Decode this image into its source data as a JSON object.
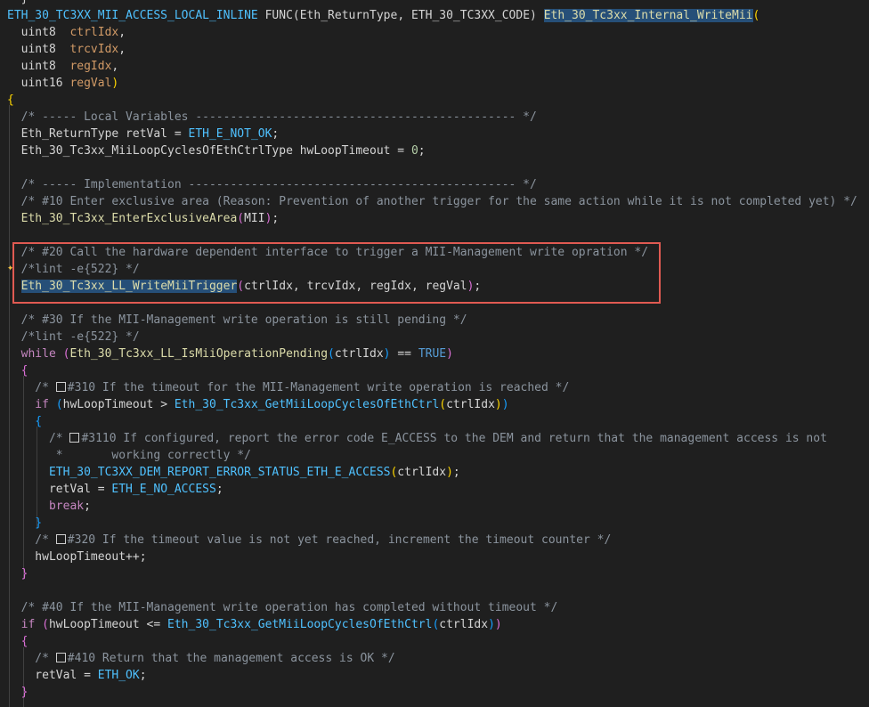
{
  "editor": {
    "lines": [
      {
        "t": "}",
        "indent": 1
      },
      {
        "segments": [
          {
            "cls": "macro",
            "text": "ETH_30_TC3XX_MII_ACCESS_LOCAL_INLINE"
          },
          {
            "cls": "punc",
            "text": " FUNC("
          },
          {
            "cls": "typ",
            "text": "Eth_ReturnType"
          },
          {
            "cls": "punc",
            "text": ", "
          },
          {
            "cls": "typ",
            "text": "ETH_30_TC3XX_CODE"
          },
          {
            "cls": "punc",
            "text": ") "
          },
          {
            "cls": "fn sel",
            "text": "Eth_30_Tc3xx_Internal_WriteMii"
          },
          {
            "cls": "brace1",
            "text": "("
          }
        ]
      },
      {
        "segments": [
          {
            "cls": "typ",
            "text": "  uint8  "
          },
          {
            "cls": "param",
            "text": "ctrlIdx"
          },
          {
            "cls": "punc",
            "text": ","
          }
        ]
      },
      {
        "segments": [
          {
            "cls": "typ",
            "text": "  uint8  "
          },
          {
            "cls": "param",
            "text": "trcvIdx"
          },
          {
            "cls": "punc",
            "text": ","
          }
        ]
      },
      {
        "segments": [
          {
            "cls": "typ",
            "text": "  uint8  "
          },
          {
            "cls": "param",
            "text": "regIdx"
          },
          {
            "cls": "punc",
            "text": ","
          }
        ]
      },
      {
        "segments": [
          {
            "cls": "typ",
            "text": "  uint16 "
          },
          {
            "cls": "param",
            "text": "regVal"
          },
          {
            "cls": "brace1",
            "text": ")"
          }
        ]
      },
      {
        "segments": [
          {
            "cls": "brace1",
            "text": "{"
          }
        ]
      },
      {
        "segments": [
          {
            "cls": "com",
            "text": "  /* ----- Local Variables ---------------------------------------------- */"
          }
        ]
      },
      {
        "segments": [
          {
            "cls": "typ",
            "text": "  Eth_ReturnType retVal = "
          },
          {
            "cls": "macro",
            "text": "ETH_E_NOT_OK"
          },
          {
            "cls": "punc",
            "text": ";"
          }
        ]
      },
      {
        "segments": [
          {
            "cls": "typ",
            "text": "  Eth_30_Tc3xx_MiiLoopCyclesOfEthCtrlType hwLoopTimeout = "
          },
          {
            "cls": "num",
            "text": "0"
          },
          {
            "cls": "punc",
            "text": ";"
          }
        ]
      },
      {
        "segments": [
          {
            "cls": "punc",
            "text": ""
          }
        ]
      },
      {
        "segments": [
          {
            "cls": "com",
            "text": "  /* ----- Implementation ----------------------------------------------- */"
          }
        ]
      },
      {
        "segments": [
          {
            "cls": "com",
            "text": "  /* #10 Enter exclusive area (Reason: Prevention of another trigger for the same action while it is not completed yet) */"
          }
        ]
      },
      {
        "segments": [
          {
            "cls": "fn macro",
            "text": "  Eth_30_Tc3xx_EnterExclusiveArea"
          },
          {
            "cls": "brace2",
            "text": "("
          },
          {
            "cls": "typ",
            "text": "MII"
          },
          {
            "cls": "brace2",
            "text": ")"
          },
          {
            "cls": "punc",
            "text": ";"
          }
        ]
      },
      {
        "segments": [
          {
            "cls": "punc",
            "text": ""
          }
        ]
      },
      {
        "segments": [
          {
            "cls": "com",
            "text": "  /* #20 Call the hardware dependent interface to trigger a MII-Management write opration */"
          }
        ]
      },
      {
        "segments": [
          {
            "cls": "com",
            "text": "  /*lint -e{522} */"
          }
        ]
      },
      {
        "segments": [
          {
            "cls": "punc",
            "text": "  "
          },
          {
            "cls": "fn sel",
            "text": "Eth_30_Tc3xx_LL_WriteMiiTrigger"
          },
          {
            "cls": "brace2",
            "text": "("
          },
          {
            "cls": "var",
            "text": "ctrlIdx, trcvIdx, regIdx, regVal"
          },
          {
            "cls": "brace2",
            "text": ")"
          },
          {
            "cls": "punc",
            "text": ";"
          }
        ]
      },
      {
        "segments": [
          {
            "cls": "punc",
            "text": ""
          }
        ]
      },
      {
        "segments": [
          {
            "cls": "com",
            "text": "  /* #30 If the MII-Management write operation is still pending */"
          }
        ]
      },
      {
        "segments": [
          {
            "cls": "com",
            "text": "  /*lint -e{522} */"
          }
        ]
      },
      {
        "segments": [
          {
            "cls": "ctrl",
            "text": "  while "
          },
          {
            "cls": "brace2",
            "text": "("
          },
          {
            "cls": "fn",
            "text": "Eth_30_Tc3xx_LL_IsMiiOperationPending"
          },
          {
            "cls": "brace3",
            "text": "("
          },
          {
            "cls": "var",
            "text": "ctrlIdx"
          },
          {
            "cls": "brace3",
            "text": ")"
          },
          {
            "cls": "punc",
            "text": " == "
          },
          {
            "cls": "kw",
            "text": "TRUE"
          },
          {
            "cls": "brace2",
            "text": ")"
          }
        ]
      },
      {
        "segments": [
          {
            "cls": "brace2",
            "text": "  {"
          }
        ]
      },
      {
        "segments": [
          {
            "cls": "com",
            "text": "    /* "
          },
          {
            "cls": "box",
            "text": ""
          },
          {
            "cls": "com",
            "text": "#310 If the timeout for the MII-Management write operation is reached */"
          }
        ]
      },
      {
        "segments": [
          {
            "cls": "ctrl",
            "text": "    if "
          },
          {
            "cls": "brace3",
            "text": "("
          },
          {
            "cls": "var",
            "text": "hwLoopTimeout > "
          },
          {
            "cls": "macro",
            "text": "Eth_30_Tc3xx_GetMiiLoopCyclesOfEthCtrl"
          },
          {
            "cls": "brace1",
            "text": "("
          },
          {
            "cls": "var",
            "text": "ctrlIdx"
          },
          {
            "cls": "brace1",
            "text": ")"
          },
          {
            "cls": "brace3",
            "text": ")"
          }
        ]
      },
      {
        "segments": [
          {
            "cls": "brace3",
            "text": "    {"
          }
        ]
      },
      {
        "segments": [
          {
            "cls": "com",
            "text": "      /* "
          },
          {
            "cls": "box",
            "text": ""
          },
          {
            "cls": "com",
            "text": "#3110 If configured, report the error code E_ACCESS to the DEM and return that the management access is not"
          }
        ]
      },
      {
        "segments": [
          {
            "cls": "com",
            "text": "       *       working correctly */"
          }
        ]
      },
      {
        "segments": [
          {
            "cls": "macro",
            "text": "      ETH_30_TC3XX_DEM_REPORT_ERROR_STATUS_ETH_E_ACCESS"
          },
          {
            "cls": "brace1",
            "text": "("
          },
          {
            "cls": "var",
            "text": "ctrlIdx"
          },
          {
            "cls": "brace1",
            "text": ")"
          },
          {
            "cls": "punc",
            "text": ";"
          }
        ]
      },
      {
        "segments": [
          {
            "cls": "var",
            "text": "      retVal = "
          },
          {
            "cls": "macro",
            "text": "ETH_E_NO_ACCESS"
          },
          {
            "cls": "punc",
            "text": ";"
          }
        ]
      },
      {
        "segments": [
          {
            "cls": "ctrl",
            "text": "      break"
          },
          {
            "cls": "punc",
            "text": ";"
          }
        ]
      },
      {
        "segments": [
          {
            "cls": "brace3",
            "text": "    }"
          }
        ]
      },
      {
        "segments": [
          {
            "cls": "com",
            "text": "    /* "
          },
          {
            "cls": "box",
            "text": ""
          },
          {
            "cls": "com",
            "text": "#320 If the timeout value is not yet reached, increment the timeout counter */"
          }
        ]
      },
      {
        "segments": [
          {
            "cls": "var",
            "text": "    hwLoopTimeout++;"
          }
        ]
      },
      {
        "segments": [
          {
            "cls": "brace2",
            "text": "  }"
          }
        ]
      },
      {
        "segments": [
          {
            "cls": "punc",
            "text": ""
          }
        ]
      },
      {
        "segments": [
          {
            "cls": "com",
            "text": "  /* #40 If the MII-Management write operation has completed without timeout */"
          }
        ]
      },
      {
        "segments": [
          {
            "cls": "ctrl",
            "text": "  if "
          },
          {
            "cls": "brace2",
            "text": "("
          },
          {
            "cls": "var",
            "text": "hwLoopTimeout <= "
          },
          {
            "cls": "macro",
            "text": "Eth_30_Tc3xx_GetMiiLoopCyclesOfEthCtrl"
          },
          {
            "cls": "brace3",
            "text": "("
          },
          {
            "cls": "var",
            "text": "ctrlIdx"
          },
          {
            "cls": "brace3",
            "text": ")"
          },
          {
            "cls": "brace2",
            "text": ")"
          }
        ]
      },
      {
        "segments": [
          {
            "cls": "brace2",
            "text": "  {"
          }
        ]
      },
      {
        "segments": [
          {
            "cls": "com",
            "text": "    /* "
          },
          {
            "cls": "box",
            "text": ""
          },
          {
            "cls": "com",
            "text": "#410 Return that the management access is OK */"
          }
        ]
      },
      {
        "segments": [
          {
            "cls": "var",
            "text": "    retVal = "
          },
          {
            "cls": "macro",
            "text": "ETH_OK"
          },
          {
            "cls": "punc",
            "text": ";"
          }
        ]
      },
      {
        "segments": [
          {
            "cls": "brace2",
            "text": "  }"
          }
        ]
      }
    ]
  }
}
